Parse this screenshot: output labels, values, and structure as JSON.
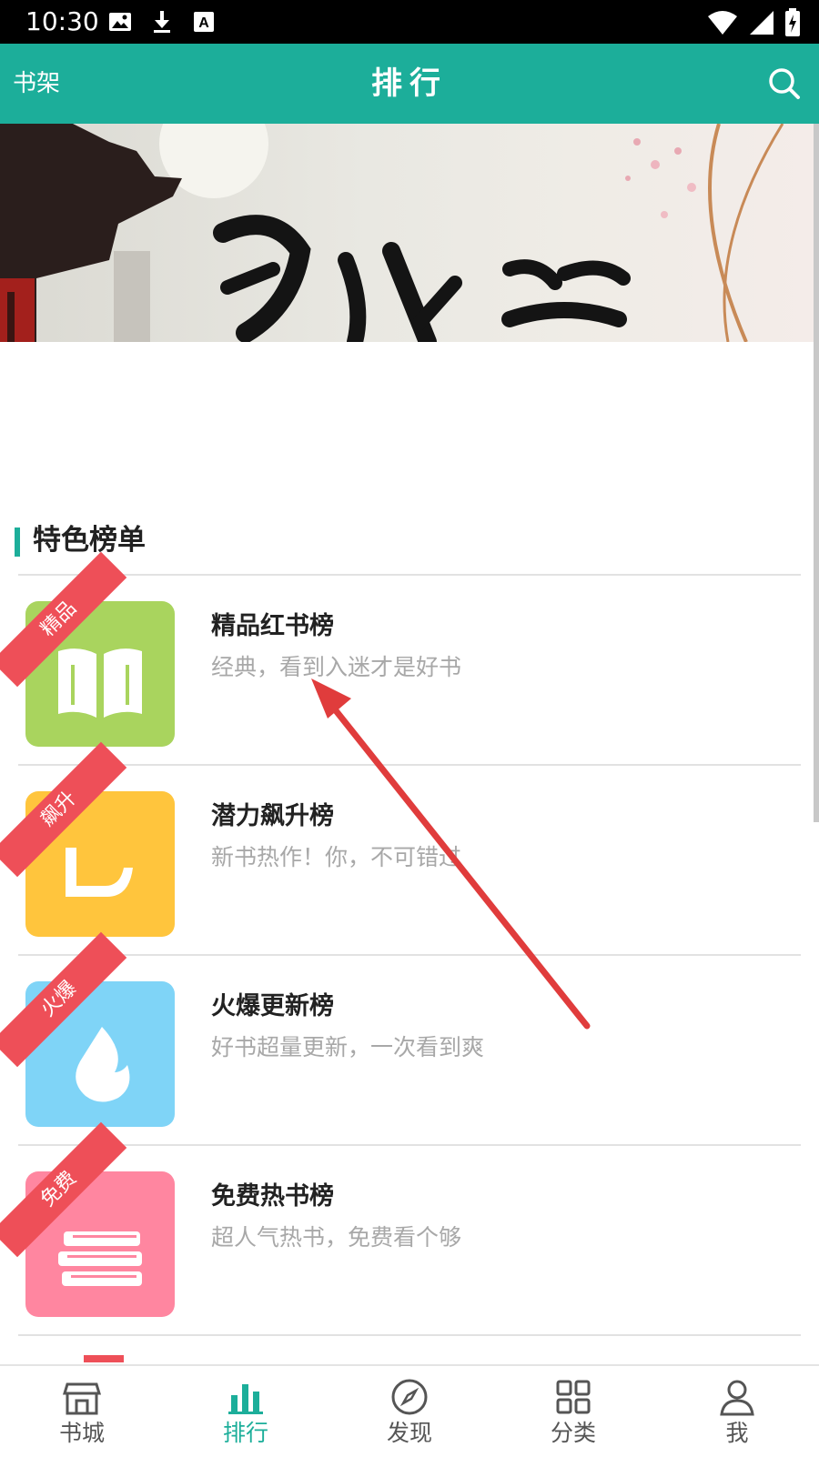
{
  "status_bar": {
    "time": "10:30",
    "left_icons": [
      "image-icon",
      "download-icon",
      "text-a-icon"
    ],
    "right_icons": [
      "wifi-icon",
      "signal-icon",
      "battery-charging-icon"
    ]
  },
  "header": {
    "left_link": "书架",
    "title": "排行",
    "search_icon": "search-icon",
    "color": "#1cae9a"
  },
  "banner": {
    "calligraphy_text": "",
    "description": "banner image with ancient building and calligraphy"
  },
  "section": {
    "title": "特色榜单"
  },
  "rank_lists": [
    {
      "title": "精品红书榜",
      "subtitle": "经典，看到入迷才是好书",
      "badge": "精品",
      "icon": "open-book-icon",
      "color": "#a9d45e"
    },
    {
      "title": "潜力飙升榜",
      "subtitle": "新书热作！你，不可错过",
      "badge": "飙升",
      "icon": "trend-up-icon",
      "color": "#ffc53d"
    },
    {
      "title": "火爆更新榜",
      "subtitle": "好书超量更新，一次看到爽",
      "badge": "火爆",
      "icon": "flame-icon",
      "color": "#7fd4f7"
    },
    {
      "title": "免费热书榜",
      "subtitle": "超人气热书，免费看个够",
      "badge": "免费",
      "icon": "book-stack-icon",
      "color": "#ff86a0"
    }
  ],
  "bottom_nav": [
    {
      "label": "书城",
      "icon": "store-icon",
      "active": false
    },
    {
      "label": "排行",
      "icon": "bar-chart-icon",
      "active": true
    },
    {
      "label": "发现",
      "icon": "compass-icon",
      "active": false
    },
    {
      "label": "分类",
      "icon": "grid-icon",
      "active": false
    },
    {
      "label": "我",
      "icon": "person-icon",
      "active": false
    }
  ],
  "colors": {
    "accent": "#1cae9a",
    "ribbon": "#ee4f58",
    "annotation_arrow": "#e03c3c"
  }
}
